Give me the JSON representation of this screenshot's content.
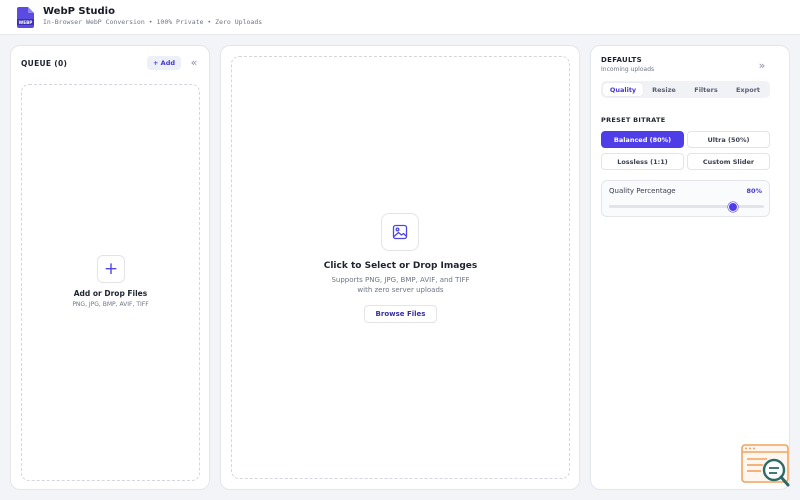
{
  "app": {
    "title": "WebP Studio",
    "subtitle": "In-Browser WebP Conversion • 100% Private • Zero Uploads",
    "logo_text": "WEBP",
    "accent_color": "#4f3ee8"
  },
  "queue": {
    "title": "QUEUE (0)",
    "add_label": "+ Add",
    "collapse_icon": "chevrons-left-icon",
    "drop_icon": "plus-icon",
    "drop_title": "Add or Drop Files",
    "drop_subtitle": "PNG, JPG, BMP, AVIF, TIFF"
  },
  "main": {
    "drop_icon": "image-icon",
    "drop_title": "Click to Select or Drop Images",
    "drop_subtitle_line1": "Supports PNG, JPG, BMP, AVIF, and TIFF",
    "drop_subtitle_line2": "with zero server uploads",
    "browse_label": "Browse Files"
  },
  "settings": {
    "title": "DEFAULTS",
    "subtitle": "Incoming uploads",
    "collapse_icon": "chevrons-right-icon",
    "tabs": [
      {
        "label": "Quality",
        "active": true
      },
      {
        "label": "Resize",
        "active": false
      },
      {
        "label": "Filters",
        "active": false
      },
      {
        "label": "Export",
        "active": false
      }
    ],
    "preset_heading": "PRESET BITRATE",
    "presets": [
      {
        "label": "Balanced (80%)",
        "active": true
      },
      {
        "label": "Ultra (50%)",
        "active": false
      },
      {
        "label": "Lossless (1:1)",
        "active": false
      },
      {
        "label": "Custom Slider",
        "active": false
      }
    ],
    "quality": {
      "label": "Quality Percentage",
      "value_text": "80%",
      "value": 80,
      "min": 0,
      "max": 100
    }
  },
  "badge": {
    "icon": "search-code-icon"
  }
}
